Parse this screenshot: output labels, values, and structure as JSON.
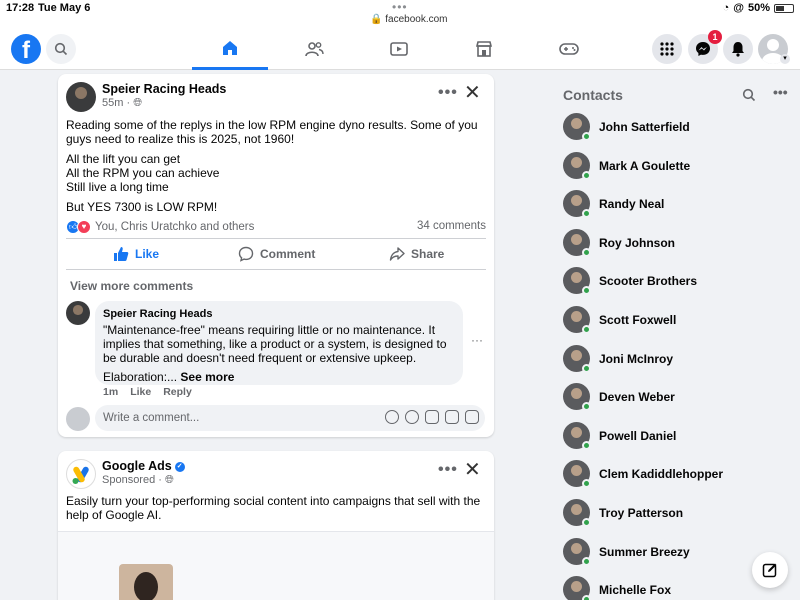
{
  "status_bar": {
    "time": "17:28",
    "date": "Tue May 6",
    "url": "facebook.com",
    "battery": "50%"
  },
  "nav": {
    "logo_letter": "f",
    "tabs": [
      "home-icon",
      "friends-icon",
      "video-icon",
      "marketplace-icon",
      "gaming-icon"
    ],
    "messenger_badge": "1"
  },
  "post": {
    "author": "Speier Racing Heads",
    "time": "55m",
    "paragraph1": "Reading some of the replys in the low RPM engine dyno results. Some of you guys need to realize this is 2025, not 1960!",
    "lines": [
      "All the lift you can get",
      "All the RPM you can achieve",
      "Still live a long time"
    ],
    "paragraph3": "But YES 7300 is LOW RPM!",
    "reactions_text": "You, Chris Uratchko and others",
    "comments_count": "34 comments",
    "actions": {
      "like": "Like",
      "comment": "Comment",
      "share": "Share"
    },
    "view_more": "View more comments",
    "comment": {
      "author": "Speier Racing Heads",
      "text": "\"Maintenance-free\" means requiring little or no maintenance. It implies that something, like a product or a system, is designed to be durable and doesn't need frequent or extensive upkeep.",
      "elaboration": "Elaboration:...",
      "see_more": "See more",
      "time": "1m",
      "like": "Like",
      "reply": "Reply"
    },
    "write_placeholder": "Write a comment..."
  },
  "ad": {
    "advertiser": "Google Ads",
    "sponsored": "Sponsored",
    "body": "Easily turn your top-performing social content into campaigns that sell with the help of Google AI."
  },
  "contacts": {
    "title": "Contacts",
    "list": [
      "John Satterfield",
      "Mark A Goulette",
      "Randy Neal",
      "Roy Johnson",
      "Scooter Brothers",
      "Scott Foxwell",
      "Joni McInroy",
      "Deven Weber",
      "Powell Daniel",
      "Clem Kadiddlehopper",
      "Troy Patterson",
      "Summer Breezy",
      "Michelle Fox"
    ]
  },
  "colors": {
    "brand": "#1877f2",
    "online": "#31a24c",
    "badge": "#e41e3f",
    "background": "#f0f2f5"
  }
}
